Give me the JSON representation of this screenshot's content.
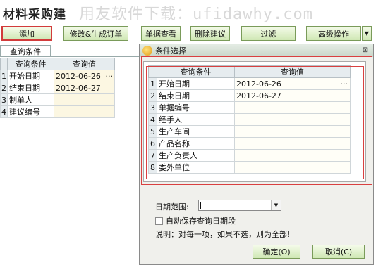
{
  "window": {
    "title": "材料采购建",
    "watermark": "用友软件下载：ufidawhy.com"
  },
  "toolbar": {
    "add": "添加",
    "modify_generate_order": "修改&生成订单",
    "view_slip": "单据查看",
    "delete_suggestion": "删除建议",
    "filter": "过滤",
    "advanced_ops": "高级操作"
  },
  "left_panel": {
    "tab_label": "查询条件",
    "columns": [
      "查询条件",
      "查询值"
    ],
    "rows": [
      {
        "num": "1",
        "cond": "开始日期",
        "value": "2012-06-26",
        "more": "···"
      },
      {
        "num": "2",
        "cond": "结束日期",
        "value": "2012-06-27",
        "more": ""
      },
      {
        "num": "3",
        "cond": "制单人",
        "value": "",
        "more": ""
      },
      {
        "num": "4",
        "cond": "建议编号",
        "value": "",
        "more": ""
      }
    ]
  },
  "dialog": {
    "title": "条件选择",
    "close": "⊠",
    "columns": [
      "查询条件",
      "查询值"
    ],
    "rows": [
      {
        "num": "1",
        "cond": "开始日期",
        "value": "2012-06-26",
        "more": "···"
      },
      {
        "num": "2",
        "cond": "结束日期",
        "value": "2012-06-27",
        "more": ""
      },
      {
        "num": "3",
        "cond": "单据编号",
        "value": "",
        "more": ""
      },
      {
        "num": "4",
        "cond": "经手人",
        "value": "",
        "more": ""
      },
      {
        "num": "5",
        "cond": "生产车间",
        "value": "",
        "more": ""
      },
      {
        "num": "6",
        "cond": "产品名称",
        "value": "",
        "more": ""
      },
      {
        "num": "7",
        "cond": "生产负责人",
        "value": "",
        "more": ""
      },
      {
        "num": "8",
        "cond": "委外单位",
        "value": "",
        "more": ""
      }
    ],
    "date_range_label": "日期范围:",
    "date_range_value": "",
    "auto_save_label": "自动保存查询日期段",
    "note": "说明：对每一项，如果不选，则为全部!",
    "ok_label": "确定(O)",
    "cancel_label": "取消(C)"
  }
}
